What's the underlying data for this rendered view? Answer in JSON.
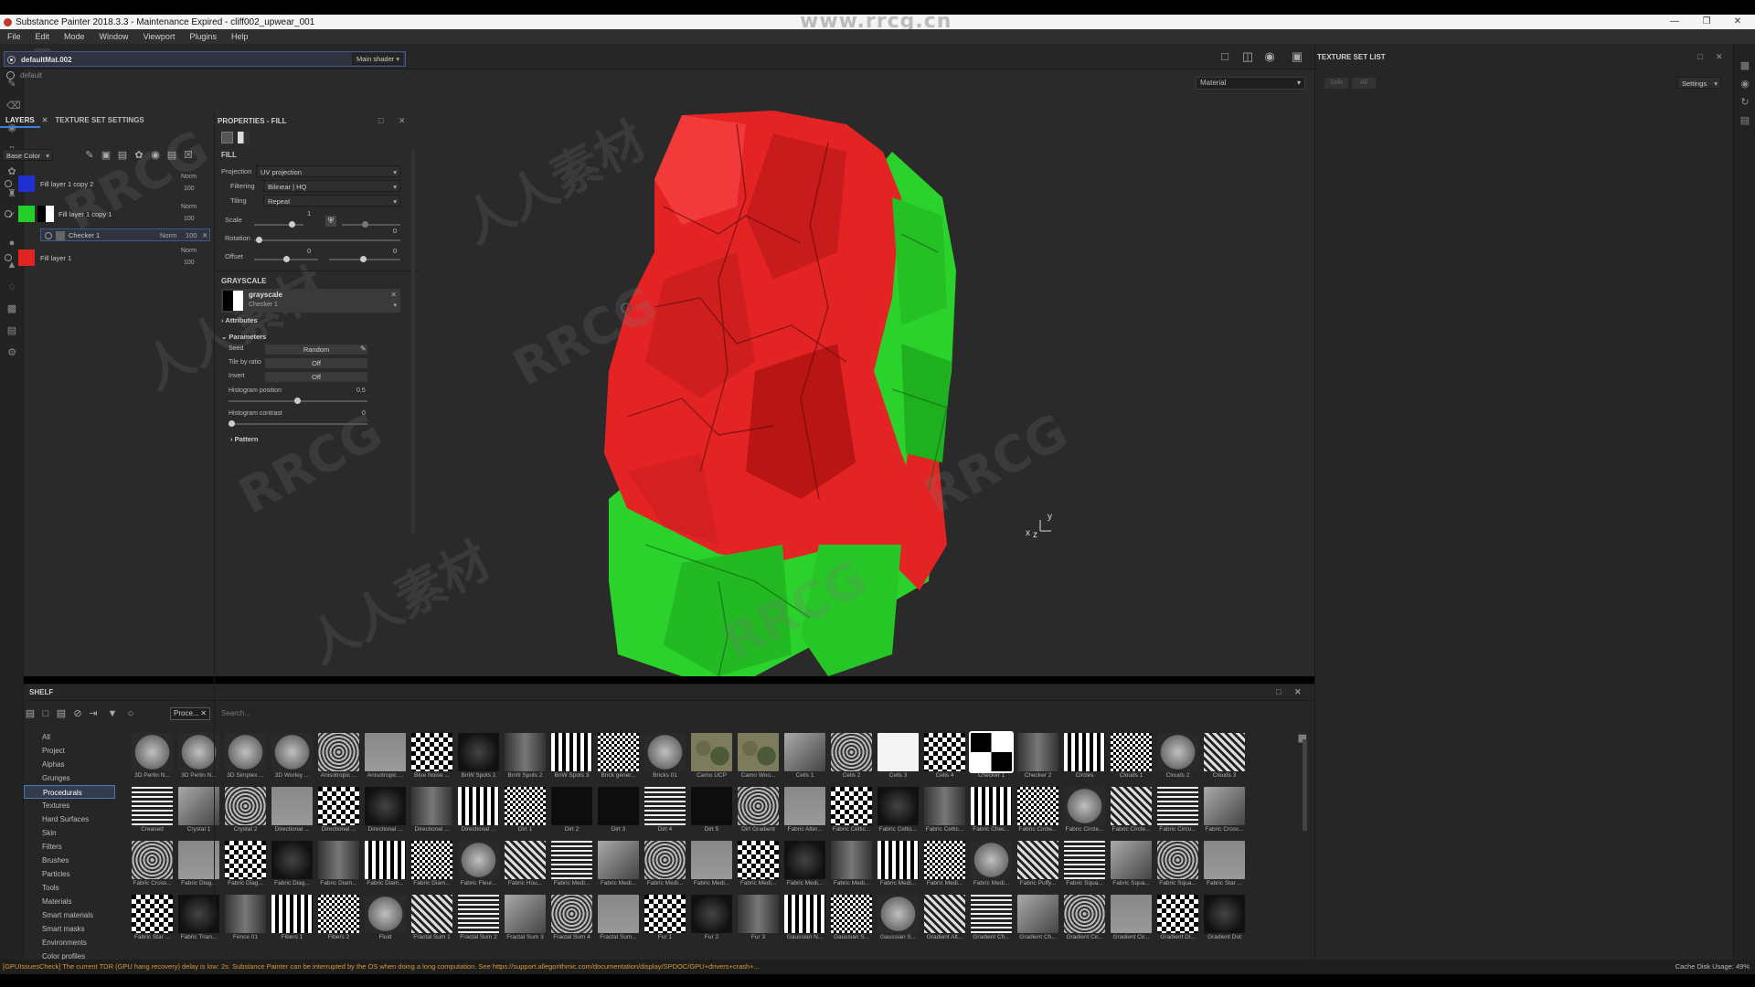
{
  "titlebar": {
    "title": "Substance Painter 2018.3.3 - Maintenance Expired - cliff002_upwear_001",
    "watermark_url": "www.rrcg.cn"
  },
  "menu": [
    "File",
    "Edit",
    "Mode",
    "Window",
    "Viewport",
    "Plugins",
    "Help"
  ],
  "viewport": {
    "mode_select": "Material",
    "axis_x": "x",
    "axis_y": "y",
    "axis_z": "z"
  },
  "watermarks": [
    "RRCG",
    "人人素材"
  ],
  "texture_set_list": {
    "title": "TEXTURE SET LIST",
    "settings_label": "Settings",
    "btn_solo": "Solo",
    "btn_all": "All",
    "items": [
      {
        "name": "defaultMat.002",
        "shader": "Main shader",
        "active": true
      },
      {
        "name": "default",
        "shader": "",
        "active": false
      }
    ]
  },
  "layers": {
    "tab_layers": "LAYERS",
    "tab_tss": "TEXTURE SET SETTINGS",
    "channel": "Base Color",
    "rows": [
      {
        "name": "Fill layer 1 copy 2",
        "blend": "Norm",
        "opacity": "100",
        "color": "#1f2fd0"
      },
      {
        "name": "Fill layer 1 copy 1",
        "blend": "Norm",
        "opacity": "100",
        "color": "#23d02a"
      },
      {
        "name": "Checker 1",
        "blend": "Norm",
        "opacity": "100",
        "color": ""
      },
      {
        "name": "Fill layer 1",
        "blend": "Norm",
        "opacity": "100",
        "color": "#e02424"
      }
    ]
  },
  "properties": {
    "title": "PROPERTIES - FILL",
    "fill_section": "FILL",
    "projection_label": "Projection",
    "projection_value": "UV projection",
    "filtering_label": "Filtering",
    "filtering_value": "Bilinear | HQ",
    "tiling_label": "Tiling",
    "tiling_value": "Repeat",
    "scale_label": "Scale",
    "scale_value": "1",
    "rotation_label": "Rotation",
    "rotation_value": "0",
    "offset_label": "Offset",
    "offset_x": "0",
    "offset_y": "0",
    "grayscale_section": "GRAYSCALE",
    "grayscale_name": "grayscale",
    "grayscale_source": "Checker 1",
    "attributes": "Attributes",
    "parameters": "Parameters",
    "seed_label": "Seed",
    "seed_value": "Random",
    "tile_by_ratio_label": "Tile by ratio",
    "tile_by_ratio_value": "Off",
    "invert_label": "Invert",
    "invert_value": "Off",
    "hist_pos_label": "Histogram position",
    "hist_pos_value": "0.5",
    "hist_contrast_label": "Histogram contrast",
    "hist_contrast_value": "0",
    "pattern": "Pattern"
  },
  "shelf": {
    "title": "SHELF",
    "filter_tag": "Proce...",
    "search_placeholder": "Search...",
    "categories": [
      "All",
      "Project",
      "Alphas",
      "Grunges",
      "Procedurals",
      "Textures",
      "Hard Surfaces",
      "Skin",
      "Filters",
      "Brushes",
      "Particles",
      "Tools",
      "Materials",
      "Smart materials",
      "Smart masks",
      "Environments",
      "Color profiles"
    ],
    "active_category": "Procedurals",
    "items": [
      "3D Perlin N...",
      "3D Perlin N...",
      "3D Simplex ...",
      "3D Worley ...",
      "Anisotropic ...",
      "Anisotropic ...",
      "Blue Noise ...",
      "BnW Spots 1",
      "BnW Spots 2",
      "BnW Spots 3",
      "Brick gener...",
      "Bricks 01",
      "Camo UCP",
      "Camo Woo...",
      "Cells 1",
      "Cells 2",
      "Cells 3",
      "Cells 4",
      "Checker 1",
      "Checker 2",
      "Circles",
      "Clouds 1",
      "Clouds 2",
      "Clouds 3",
      "Creased",
      "Crystal 1",
      "Crystal 2",
      "Directional ...",
      "Directional ...",
      "Directional ...",
      "Directional ...",
      "Directional ...",
      "Dirt 1",
      "Dirt 2",
      "Dirt 3",
      "Dirt 4",
      "Dirt 5",
      "Dirt Gradient",
      "Fabric Alter...",
      "Fabric Celtic...",
      "Fabric Celtic...",
      "Fabric Celtic...",
      "Fabric Chec...",
      "Fabric Circle...",
      "Fabric Circle...",
      "Fabric Circle...",
      "Fabric Circu...",
      "Fabric Cross...",
      "Fabric Cross...",
      "Fabric Diag...",
      "Fabric Diag...",
      "Fabric Diag...",
      "Fabric Diam...",
      "Fabric Diam...",
      "Fabric Diam...",
      "Fabric Fleur...",
      "Fabric Hou...",
      "Fabric Medi...",
      "Fabric Medi...",
      "Fabric Medi...",
      "Fabric Medi...",
      "Fabric Medi...",
      "Fabric Medi...",
      "Fabric Medi...",
      "Fabric Medi...",
      "Fabric Medi...",
      "Fabric Medi...",
      "Fabric Puffy...",
      "Fabric Squa...",
      "Fabric Squa...",
      "Fabric Squa...",
      "Fabric Star ...",
      "Fabric Star ...",
      "Fabric Trian...",
      "Fence 01",
      "Fibers 1",
      "Fibers 2",
      "Fluid",
      "Fractal Sum 1",
      "Fractal Sum 2",
      "Fractal Sum 3",
      "Fractal Sum 4",
      "Fractal Sum...",
      "Fur 1",
      "Fur 2",
      "Fur 3",
      "Gaussian N...",
      "Gaussian S...",
      "Gaussian S...",
      "Gradient Alt...",
      "Gradient Ch...",
      "Gradient Ch...",
      "Gradient Cir...",
      "Gradient Cir...",
      "Gradient Di...",
      "Gradient Dot"
    ],
    "selected_item": "Checker 1"
  },
  "status": {
    "message": "[GPUIssuesCheck] The current TDR (GPU hang recovery) delay is low: 2s. Substance Painter can be interrupted by the OS when doing a long computation. See https://support.allegorithmic.com/documentation/display/SPDOC/GPU+drivers+crash+...",
    "cache": "Cache Disk Usage:    49%"
  }
}
